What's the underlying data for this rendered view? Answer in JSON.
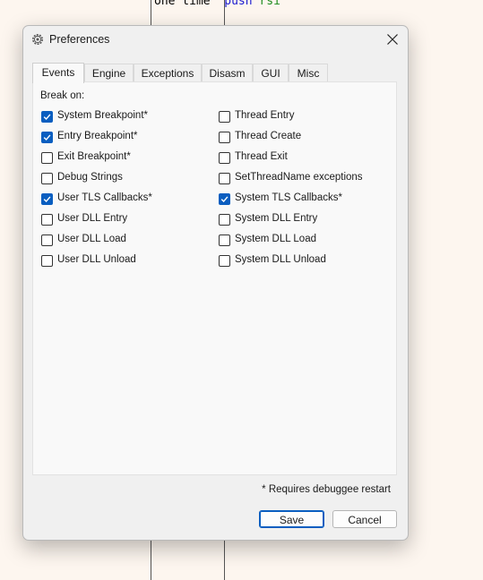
{
  "background": {
    "code_fragment": {
      "col1": "one time",
      "keyword": "push",
      "register": "rsi"
    }
  },
  "dialog": {
    "title": "Preferences",
    "icon": "gear-icon",
    "close_icon": "close-icon",
    "tabs": [
      {
        "label": "Events",
        "active": true
      },
      {
        "label": "Engine",
        "active": false
      },
      {
        "label": "Exceptions",
        "active": false
      },
      {
        "label": "Disasm",
        "active": false
      },
      {
        "label": "GUI",
        "active": false
      },
      {
        "label": "Misc",
        "active": false
      }
    ],
    "break_on_label": "Break on:",
    "left_column": [
      {
        "label": "System Breakpoint*",
        "checked": true
      },
      {
        "label": "Entry Breakpoint*",
        "checked": true
      },
      {
        "label": "Exit Breakpoint*",
        "checked": false
      },
      {
        "label": "Debug Strings",
        "checked": false
      },
      {
        "label": "User TLS Callbacks*",
        "checked": true
      },
      {
        "label": "User DLL Entry",
        "checked": false
      },
      {
        "label": "User DLL Load",
        "checked": false
      },
      {
        "label": "User DLL Unload",
        "checked": false
      }
    ],
    "right_column": [
      {
        "label": "Thread Entry",
        "checked": false
      },
      {
        "label": "Thread Create",
        "checked": false
      },
      {
        "label": "Thread Exit",
        "checked": false
      },
      {
        "label": "SetThreadName exceptions",
        "checked": false
      },
      {
        "label": "System TLS Callbacks*",
        "checked": true
      },
      {
        "label": "System DLL Entry",
        "checked": false
      },
      {
        "label": "System DLL Load",
        "checked": false
      },
      {
        "label": "System DLL Unload",
        "checked": false
      }
    ],
    "note": "* Requires debuggee restart",
    "save_label": "Save",
    "cancel_label": "Cancel",
    "accent_color": "#0a5ec0"
  }
}
